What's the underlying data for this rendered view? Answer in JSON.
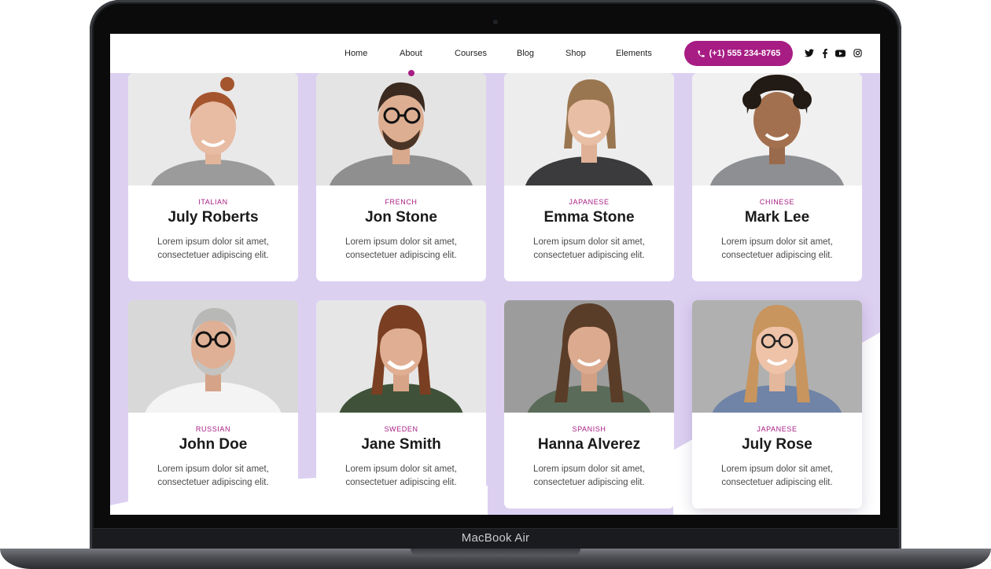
{
  "device": {
    "label": "MacBook Air"
  },
  "nav": {
    "items": [
      {
        "label": "Home"
      },
      {
        "label": "About"
      },
      {
        "label": "Courses"
      },
      {
        "label": "Blog"
      },
      {
        "label": "Shop"
      },
      {
        "label": "Elements"
      }
    ],
    "active": "About",
    "phone": "(+1) 555 234-8765",
    "social_icons": [
      "twitter-icon",
      "facebook-icon",
      "youtube-icon",
      "instagram-icon"
    ]
  },
  "colors": {
    "accent": "#a71d84",
    "background_shape": "#dcd0f1",
    "card": "#ffffff"
  },
  "teachers": [
    {
      "language": "ITALIAN",
      "name": "July Roberts",
      "desc_1": "Lorem ipsum dolor sit amet,",
      "desc_2": "consectetuer adipiscing elit.",
      "photo": "woman-portrait"
    },
    {
      "language": "FRENCH",
      "name": "Jon Stone",
      "desc_1": "Lorem ipsum dolor sit amet,",
      "desc_2": "consectetuer adipiscing elit.",
      "photo": "man-portrait"
    },
    {
      "language": "JAPANESE",
      "name": "Emma Stone",
      "desc_1": "Lorem ipsum dolor sit amet,",
      "desc_2": "consectetuer adipiscing elit.",
      "photo": "woman-portrait"
    },
    {
      "language": "CHINESE",
      "name": "Mark Lee",
      "desc_1": "Lorem ipsum dolor sit amet,",
      "desc_2": "consectetuer adipiscing elit.",
      "photo": "man-portrait"
    },
    {
      "language": "RUSSIAN",
      "name": "John Doe",
      "desc_1": "Lorem ipsum dolor sit amet,",
      "desc_2": "consectetuer adipiscing elit.",
      "photo": "man-portrait"
    },
    {
      "language": "SWEDEN",
      "name": "Jane Smith",
      "desc_1": "Lorem ipsum dolor sit amet,",
      "desc_2": "consectetuer adipiscing elit.",
      "photo": "woman-portrait"
    },
    {
      "language": "SPANISH",
      "name": "Hanna Alverez",
      "desc_1": "Lorem ipsum dolor sit amet,",
      "desc_2": "consectetuer adipiscing elit.",
      "photo": "woman-portrait"
    },
    {
      "language": "JAPANESE",
      "name": "July Rose",
      "desc_1": "Lorem ipsum dolor sit amet,",
      "desc_2": "consectetuer adipiscing elit.",
      "photo": "woman-portrait"
    }
  ]
}
